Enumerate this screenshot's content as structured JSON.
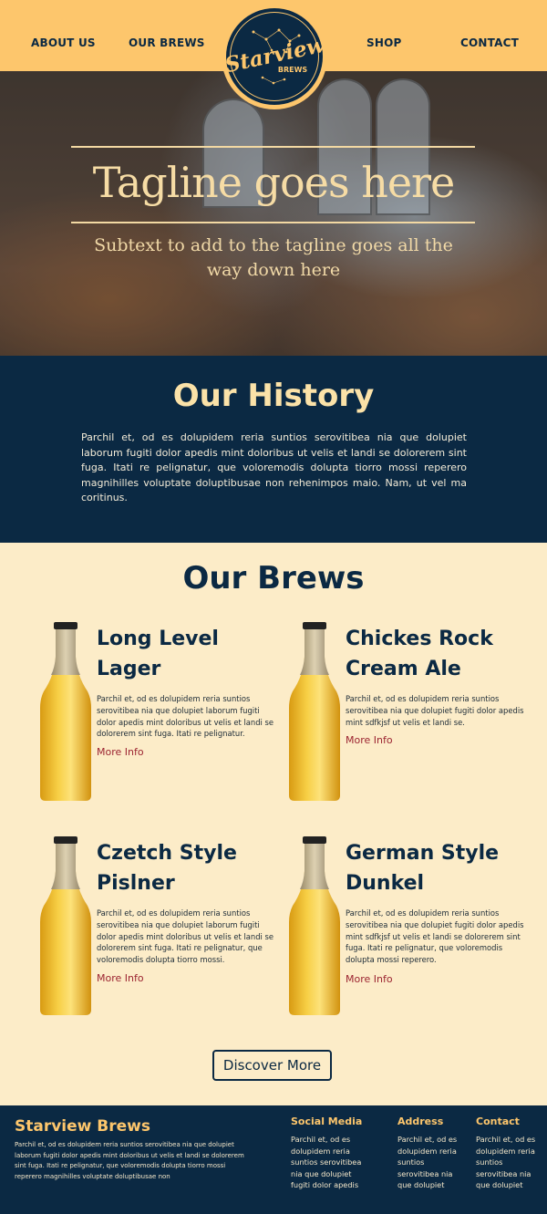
{
  "nav": {
    "items": [
      "ABOUT US",
      "OUR BREWS",
      "SHOP",
      "CONTACT"
    ],
    "logo": {
      "name": "Starview",
      "sub": "BREWS"
    }
  },
  "hero": {
    "tagline": "Tagline goes here",
    "subtext": "Subtext to add to the tagline goes all the way down here"
  },
  "history": {
    "title": "Our History",
    "body": "Parchil et, od es dolupidem reria suntios serovitibea nia que dolupiet laborum fugiti dolor apedis mint doloribus ut velis et landi se dolorerem sint fuga. Itati re pelignatur, que voloremodis dolupta tiorro mossi reperero magnihilles voluptate doluptibusae non rehenimpos maio. Nam, ut vel ma coritinus."
  },
  "brews": {
    "title": "Our Brews",
    "items": [
      {
        "name": "Long Level Lager",
        "desc": "Parchil et, od es dolupidem reria suntios serovitibea nia que dolupiet laborum fugiti dolor apedis mint doloribus ut velis et landi se dolorerem sint fuga. Itati re pelignatur.",
        "link": "More Info"
      },
      {
        "name": "Chickes Rock Cream Ale",
        "desc": "Parchil et, od es dolupidem reria suntios serovitibea nia que dolupiet  fugiti dolor apedis mint sdfkjsf ut velis et landi se.",
        "link": "More Info"
      },
      {
        "name": "Czetch Style Pislner",
        "desc": "Parchil et, od es dolupidem reria suntios serovitibea nia que dolupiet laborum fugiti dolor apedis mint doloribus ut velis et landi se dolorerem sint fuga. Itati re pelignatur, que voloremodis dolupta tiorro mossi.",
        "link": "More Info"
      },
      {
        "name": "German Style Dunkel",
        "desc": "Parchil et, od es dolupidem reria suntios serovitibea nia que dolupiet  fugiti dolor apedis mint sdfkjsf ut velis et landi se dolorerem sint fuga. Itati re pelignatur, que voloremodis dolupta mossi reperero.",
        "link": "More Info"
      }
    ],
    "discover_label": "Discover More"
  },
  "footer": {
    "brand": "Starview Brews",
    "about": "Parchil et, od es dolupidem reria suntios serovitibea nia que dolupiet laborum fugiti dolor apedis mint doloribus ut velis et landi se dolorerem sint fuga. Itati re pelignatur, que voloremodis dolupta tiorro mossi reperero magnihilles voluptate doluptibusae non",
    "social": {
      "title": "Social Media",
      "body": "Parchil et, od es dolupidem reria suntios serovitibea nia que dolupiet fugiti dolor apedis"
    },
    "address": {
      "title": "Address",
      "body": "Parchil et, od es dolupidem reria suntios serovitibea nia que dolupiet"
    },
    "contact": {
      "title": "Contact",
      "body": "Parchil et, od es dolupidem reria suntios serovitibea nia que dolupiet"
    }
  },
  "colors": {
    "nav_bg": "#fdc66c",
    "navy": "#0b2943",
    "cream": "#fcecc8",
    "link_red": "#9b2330"
  }
}
